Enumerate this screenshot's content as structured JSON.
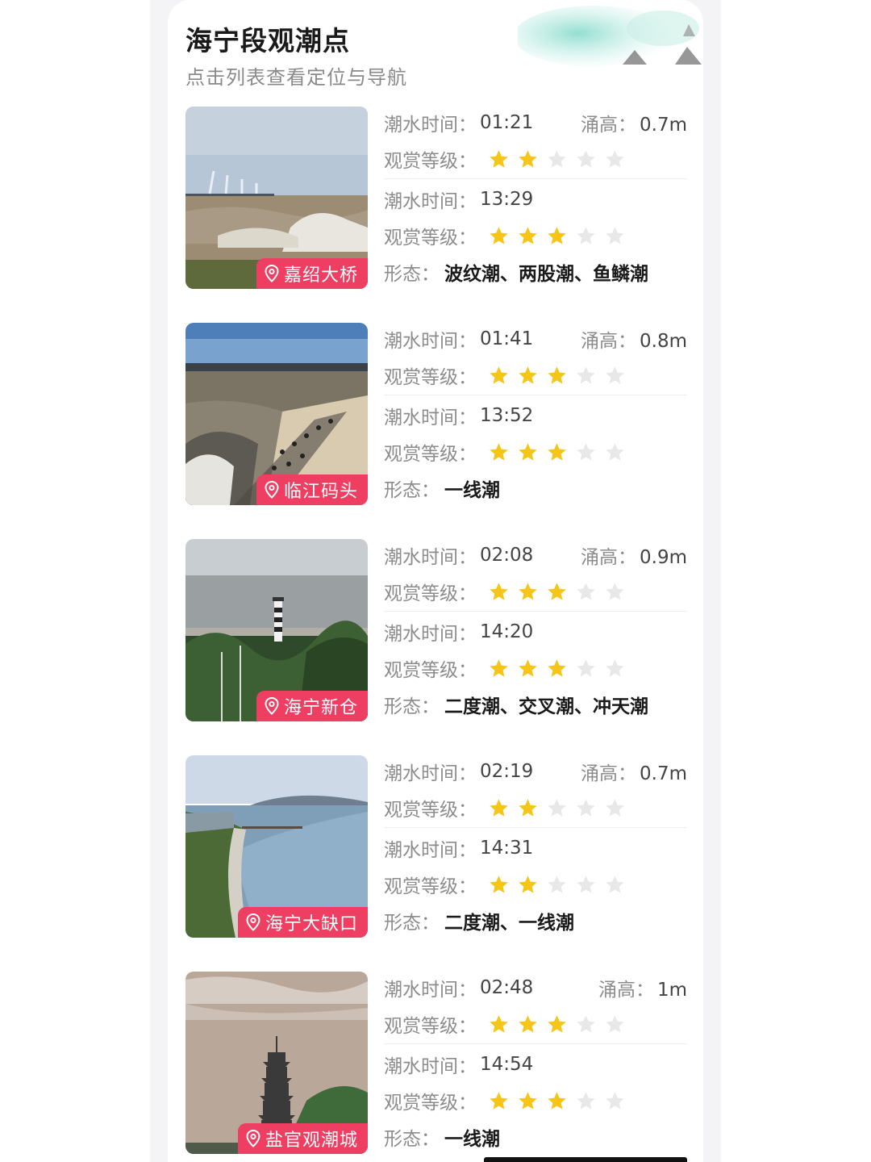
{
  "header": {
    "title": "海宁段观潮点",
    "subtitle": "点击列表查看定位与导航"
  },
  "labels": {
    "tide_time": "潮水时间：",
    "rating": "观赏等级：",
    "surge_height": "涌高：",
    "form": "形态："
  },
  "colors": {
    "accent": "#ee3f62",
    "star_on": "#f5c518",
    "star_off": "#e8e8e8"
  },
  "spots": [
    {
      "name": "嘉绍大桥",
      "tide1": {
        "time": "01:21",
        "height": "0.7m",
        "stars": 2
      },
      "tide2": {
        "time": "13:29",
        "stars": 3
      },
      "form": "波纹潮、两股潮、鱼鳞潮"
    },
    {
      "name": "临江码头",
      "tide1": {
        "time": "01:41",
        "height": "0.8m",
        "stars": 3
      },
      "tide2": {
        "time": "13:52",
        "stars": 3
      },
      "form": "一线潮"
    },
    {
      "name": "海宁新仓",
      "tide1": {
        "time": "02:08",
        "height": "0.9m",
        "stars": 3
      },
      "tide2": {
        "time": "14:20",
        "stars": 3
      },
      "form": "二度潮、交叉潮、冲天潮"
    },
    {
      "name": "海宁大缺口",
      "tide1": {
        "time": "02:19",
        "height": "0.7m",
        "stars": 2
      },
      "tide2": {
        "time": "14:31",
        "stars": 2
      },
      "form": "二度潮、一线潮"
    },
    {
      "name": "盐官观潮城",
      "tide1": {
        "time": "02:48",
        "height": "1m",
        "stars": 3
      },
      "tide2": {
        "time": "14:54",
        "stars": 3
      },
      "form": "一线潮"
    }
  ]
}
